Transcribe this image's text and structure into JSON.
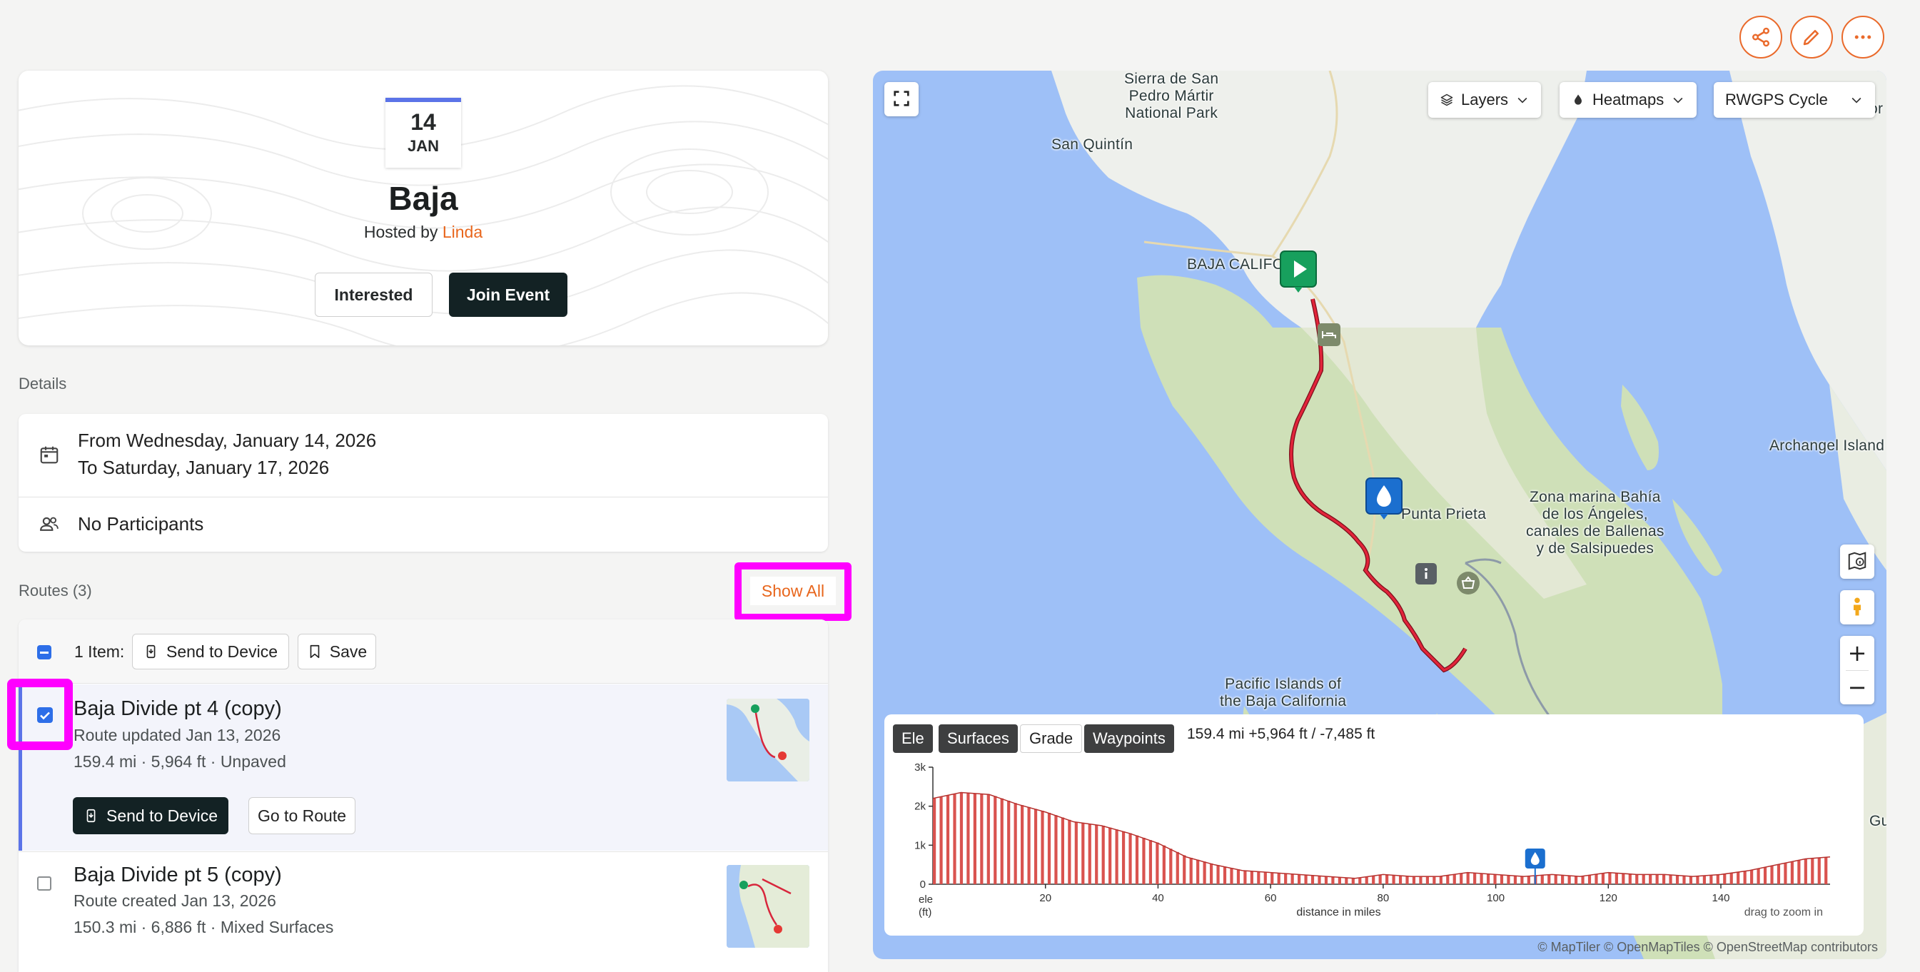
{
  "actions": {
    "share_icon": "share-icon",
    "edit_icon": "pencil-icon",
    "more_icon": "more-icon"
  },
  "event": {
    "day": "14",
    "month": "JAN",
    "title": "Baja",
    "hosted_prefix": "Hosted by ",
    "host": "Linda",
    "interested_label": "Interested",
    "join_label": "Join Event"
  },
  "details": {
    "label": "Details",
    "date_from": "From Wednesday, January 14, 2026",
    "date_to": "To Saturday, January 17, 2026",
    "participants": "No Participants"
  },
  "routes": {
    "label": "Routes (3)",
    "show_all": "Show All",
    "selection_count": "1 Item:",
    "send_to_device": "Send to Device",
    "save": "Save",
    "items": [
      {
        "title": "Baja Divide pt 4 (copy)",
        "updated": "Route updated Jan 13, 2026",
        "stats": "159.4 mi · 5,964 ft · Unpaved",
        "checked": true,
        "send_label": "Send to Device",
        "goto_label": "Go to Route"
      },
      {
        "title": "Baja Divide pt 5 (copy)",
        "updated": "Route created Jan 13, 2026",
        "stats": "150.3 mi · 6,886 ft · Mixed Surfaces",
        "checked": false
      }
    ]
  },
  "map": {
    "layers_label": "Layers",
    "heatmaps_label": "Heatmaps",
    "style_label": "RWGPS Cycle",
    "labels": {
      "sierra": "Sierra de San\nPedro Mártir\nNational Park",
      "san_quintin": "San Quintín",
      "baja_california": "BAJA CALIFOR",
      "archangel": "Archangel Island",
      "zona_marina": "Zona marina Bahía\nde los Ángeles,\ncanales de Ballenas\ny de Salsipuedes",
      "punta_prieta": "Punta Prieta",
      "pacific_islands": "Pacific Islands of\nthe Baja California",
      "edge_or": "or",
      "edge_gu": "Gu"
    },
    "zoom_in": "+",
    "zoom_out": "−",
    "attribution": "© MapTiler © OpenMapTiles © OpenStreetMap contributors"
  },
  "elevation": {
    "tabs": [
      "Ele",
      "Surfaces",
      "Grade",
      "Waypoints"
    ],
    "stats": "159.4 mi +5,964 ft / -7,485 ft",
    "y_ticks": [
      "3k",
      "2k",
      "1k",
      "0"
    ],
    "x_ticks": [
      "20",
      "40",
      "60",
      "80",
      "100",
      "120",
      "140"
    ],
    "y_label_1": "ele",
    "y_label_2": "(ft)",
    "x_label": "distance in miles",
    "hint": "drag to zoom in"
  },
  "chart_data": {
    "type": "area",
    "xlabel": "distance in miles",
    "ylabel": "ele (ft)",
    "xlim": [
      0,
      159.4
    ],
    "ylim": [
      0,
      3000
    ],
    "x": [
      0,
      5,
      10,
      15,
      20,
      25,
      30,
      35,
      40,
      45,
      50,
      55,
      60,
      65,
      70,
      75,
      80,
      85,
      90,
      95,
      100,
      105,
      110,
      115,
      120,
      125,
      130,
      135,
      140,
      145,
      150,
      155,
      159.4
    ],
    "y": [
      2200,
      2350,
      2300,
      2050,
      1850,
      1600,
      1500,
      1300,
      1050,
      700,
      500,
      350,
      300,
      250,
      200,
      150,
      250,
      200,
      200,
      300,
      250,
      200,
      250,
      200,
      300,
      250,
      250,
      200,
      250,
      350,
      500,
      650,
      700
    ],
    "colors": {
      "fill": "#d9534f",
      "route": "#d8263c",
      "accent": "#e8661c"
    }
  }
}
